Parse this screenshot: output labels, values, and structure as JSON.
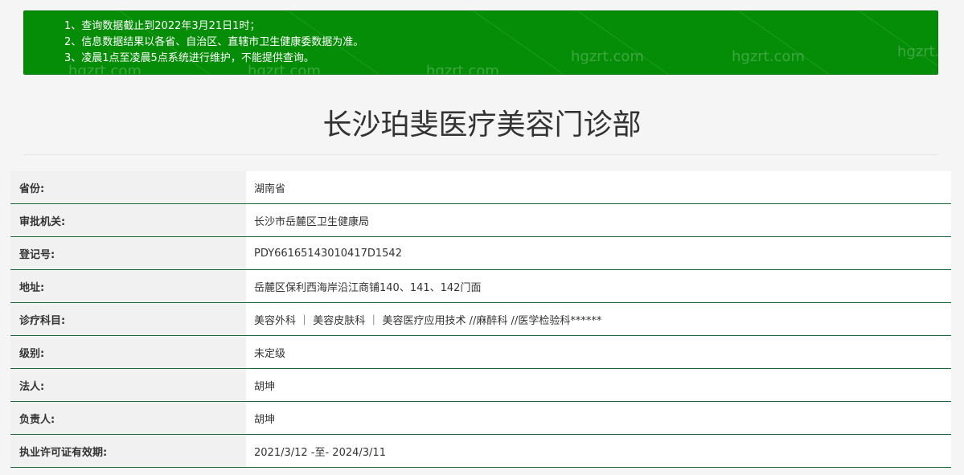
{
  "notice": {
    "lines": [
      "1、查询数据截止到2022年3月21日1时；",
      "2、信息数据结果以各省、自治区、直辖市卫生健康委数据为准。",
      "3、凌晨1点至凌晨5点系统进行维护，不能提供查询。"
    ],
    "watermark": "hgzrt.com",
    "background_color": "#068d08"
  },
  "title": "长沙珀斐医疗美容门诊部",
  "rows": [
    {
      "label": "省份:",
      "value": "湖南省"
    },
    {
      "label": "审批机关:",
      "value": "长沙市岳麓区卫生健康局"
    },
    {
      "label": "登记号:",
      "value": "PDY66165143010417D1542"
    },
    {
      "label": "地址:",
      "value": "岳麓区保利西海岸沿江商铺140、141、142门面"
    },
    {
      "label": "诊疗科目:",
      "value": "美容外科 ｜ 美容皮肤科 ｜ 美容医疗应用技术 //麻醉科 //医学检验科******"
    },
    {
      "label": "级别:",
      "value": "未定级"
    },
    {
      "label": "法人:",
      "value": "胡坤"
    },
    {
      "label": "负责人:",
      "value": "胡坤"
    },
    {
      "label": "执业许可证有效期:",
      "value": "2021/3/12 -至- 2024/3/11"
    }
  ],
  "colors": {
    "row_border": "#1c6b3a",
    "label_bg": "#f1f1f1",
    "value_bg": "#ffffff"
  }
}
